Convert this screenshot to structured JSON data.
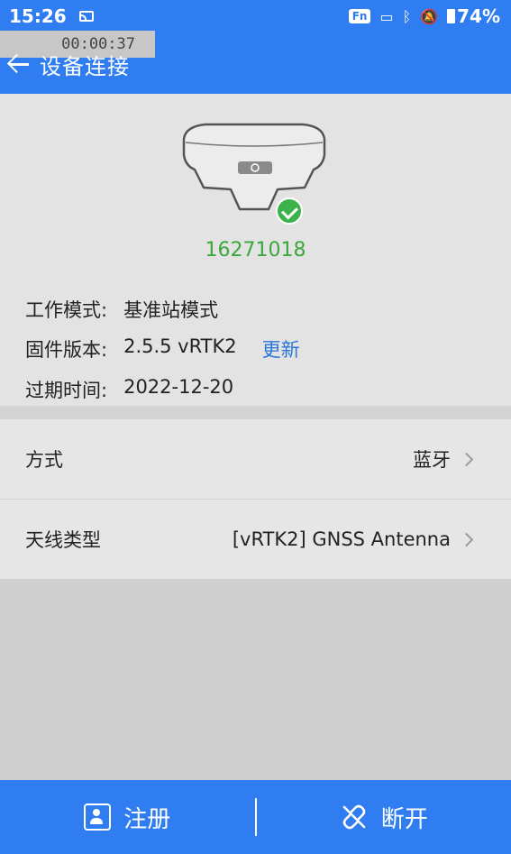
{
  "status_bar": {
    "time": "15:26",
    "fn_badge": "Fn",
    "battery": "74%"
  },
  "recording": {
    "timer": "00:00:37"
  },
  "header": {
    "title": "设备连接"
  },
  "device": {
    "serial": "16271018",
    "connected": true
  },
  "info": {
    "mode_label": "工作模式:",
    "mode_value": "基准站模式",
    "firmware_label": "固件版本:",
    "firmware_value": "2.5.5  vRTK2",
    "update_link": "更新",
    "expiry_label": "过期时间:",
    "expiry_value": "2022-12-20"
  },
  "settings": {
    "method_label": "方式",
    "method_value": "蓝牙",
    "antenna_label": "天线类型",
    "antenna_value": "[vRTK2] GNSS Antenna"
  },
  "bottom_bar": {
    "register_label": "注册",
    "disconnect_label": "断开"
  },
  "colors": {
    "primary": "#2f7df0",
    "serial_green": "#3aa83a",
    "link_blue": "#2a76d8",
    "check_green": "#3cb34a"
  }
}
